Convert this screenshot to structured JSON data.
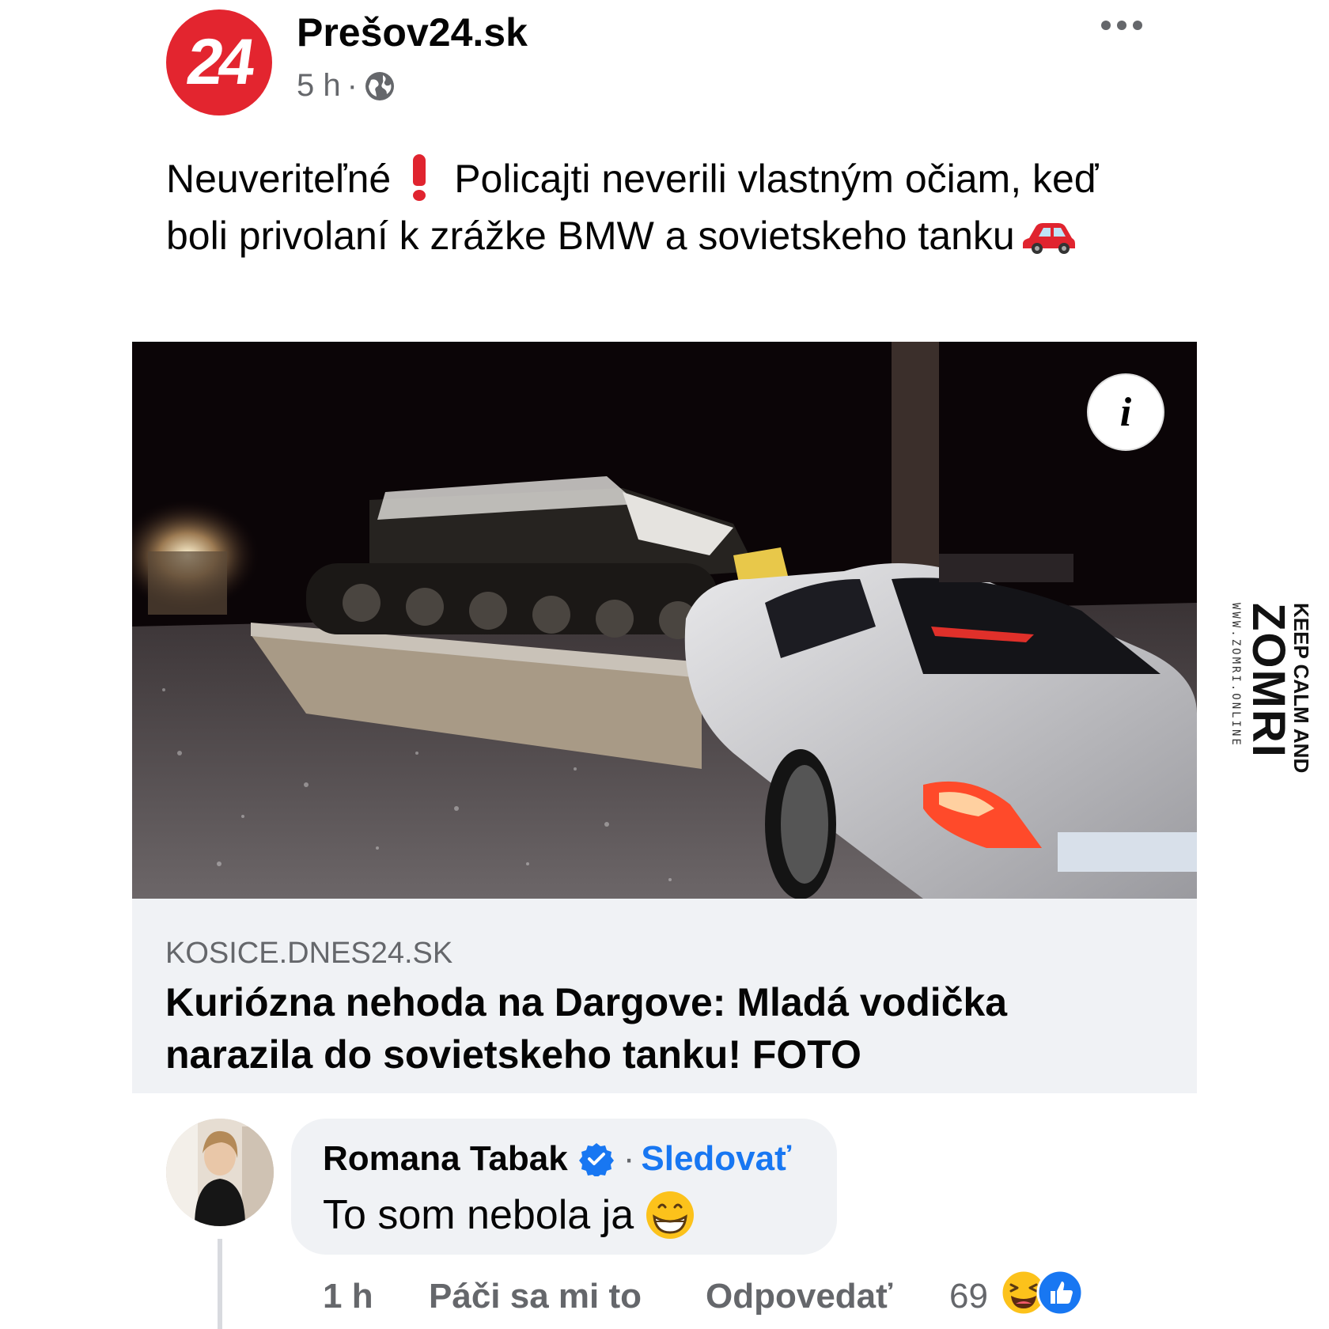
{
  "post": {
    "page_name": "Prešov24.sk",
    "logo_text": "24",
    "time": "5 h",
    "dot": "·",
    "caption": {
      "part1": "Neuveriteľné",
      "part2": "Policajti neverili vlastným očiam, keď boli privolaní k zrážke BMW a sovietskeho tanku"
    }
  },
  "link": {
    "domain": "KOSICE.DNES24.SK",
    "title": "Kuriózna nehoda na Dargove: Mladá vodička narazila do sovietskeho tanku! FOTO"
  },
  "watermark": {
    "line1": "KEEP CALM AND",
    "line2": "ZOMRI",
    "line3": "WWW.ZOMRI.ONLINE"
  },
  "comment": {
    "author": "Romana Tabak",
    "dot": "·",
    "follow": "Sledovať",
    "text": "To som nebola ja",
    "time": "1 h",
    "like": "Páči sa mi to",
    "reply": "Odpovedať",
    "reaction_count": "69"
  },
  "colors": {
    "brand_red": "#e3252f",
    "link_blue": "#1877f2",
    "muted": "#65676b",
    "card_bg": "#f0f2f5"
  },
  "icons": [
    "globe-icon",
    "more-icon",
    "exclamation-icon",
    "car-icon",
    "info-icon",
    "verified-icon",
    "grin-icon",
    "haha-reaction-icon",
    "like-reaction-icon"
  ]
}
